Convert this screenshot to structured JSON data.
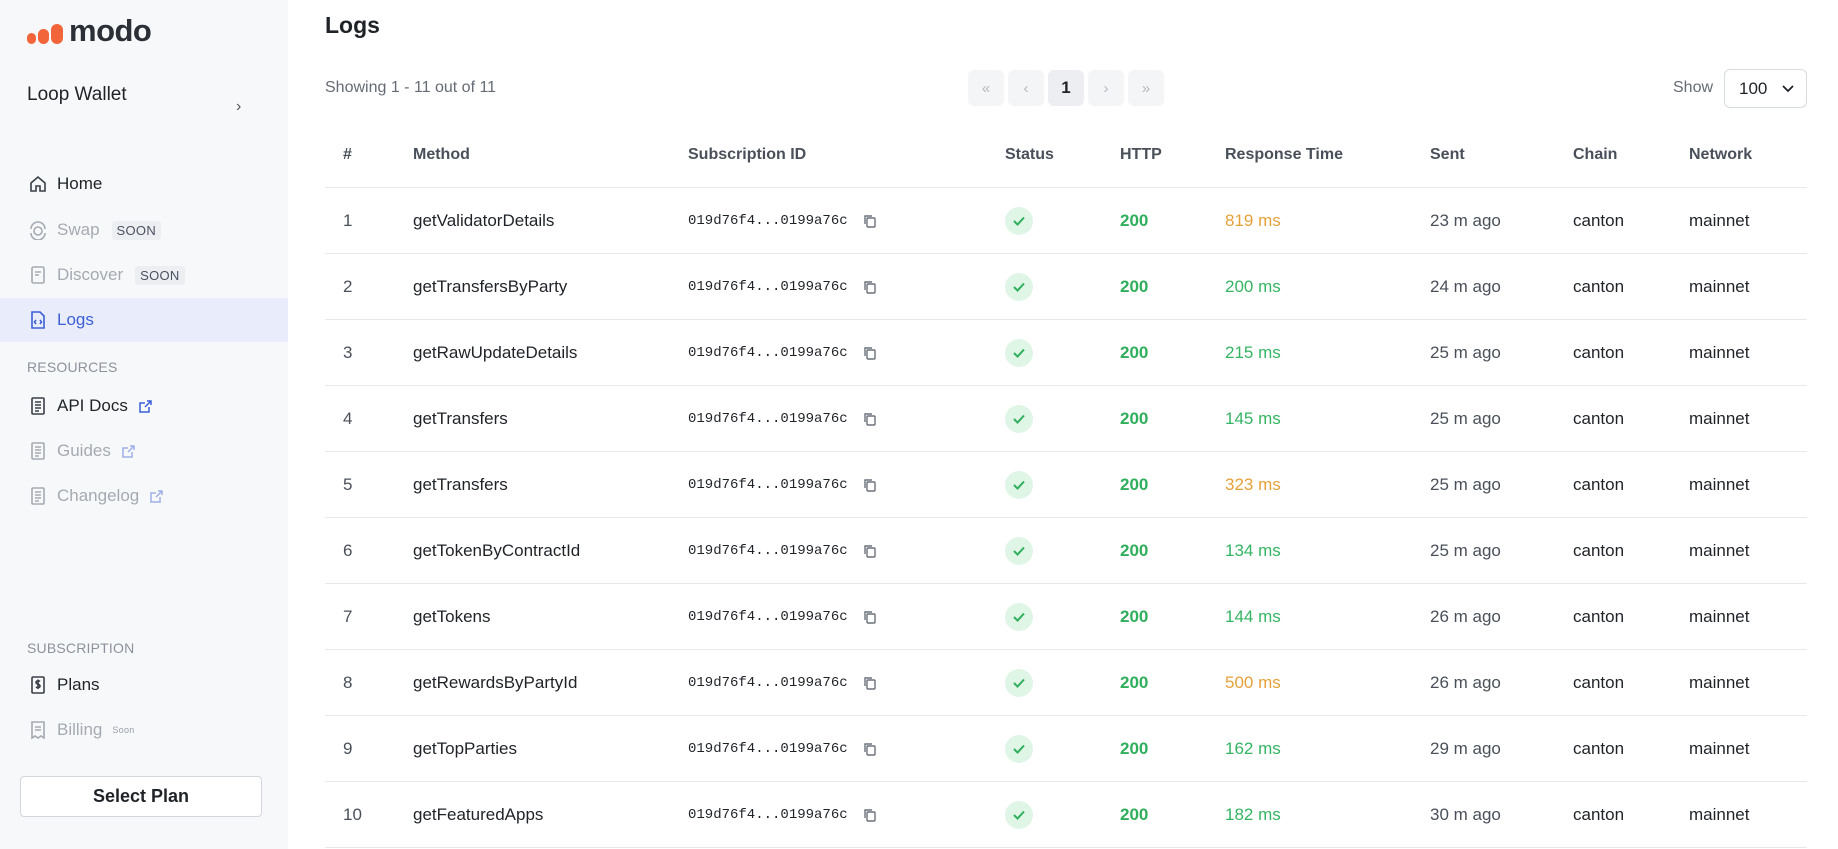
{
  "brand": {
    "name": "modo",
    "accent": "#f2643a"
  },
  "project": {
    "name": "Loop Wallet"
  },
  "nav": [
    {
      "label": "Home",
      "badge": "",
      "icon": "home-icon",
      "state": "normal"
    },
    {
      "label": "Swap",
      "badge": "SOON",
      "icon": "swap-icon",
      "state": "dim"
    },
    {
      "label": "Discover",
      "badge": "SOON",
      "icon": "document-icon",
      "state": "dim"
    },
    {
      "label": "Logs",
      "badge": "",
      "icon": "code-file-icon",
      "state": "active"
    }
  ],
  "resources": {
    "label": "RESOURCES",
    "items": [
      {
        "label": "API Docs",
        "icon": "doc-icon",
        "state": "normal"
      },
      {
        "label": "Guides",
        "icon": "doc-icon",
        "state": "dim"
      },
      {
        "label": "Changelog",
        "icon": "doc-icon",
        "state": "dim"
      }
    ]
  },
  "subscription": {
    "label": "SUBSCRIPTION",
    "items": [
      {
        "label": "Plans",
        "badge": "",
        "icon": "dollar-doc-icon",
        "state": "normal"
      },
      {
        "label": "Billing",
        "badge": "Soon",
        "icon": "receipt-icon",
        "state": "dim"
      }
    ]
  },
  "select_plan_label": "Select Plan",
  "main": {
    "title": "Logs",
    "showing": "Showing 1 - 11 out of 11",
    "pager": {
      "first": "«",
      "prev": "‹",
      "current": "1",
      "next": "›",
      "last": "»"
    },
    "show_label": "Show",
    "show_value": "100"
  },
  "table": {
    "columns": [
      "#",
      "Method",
      "Subscription ID",
      "Status",
      "HTTP",
      "Response Time",
      "Sent",
      "Chain",
      "Network"
    ],
    "rows": [
      {
        "n": "1",
        "method": "getValidatorDetails",
        "sub": "019d76f4...0199a76c",
        "http": "200",
        "rt": "819 ms",
        "rt_level": "slow",
        "sent": "23 m ago",
        "chain": "canton",
        "network": "mainnet"
      },
      {
        "n": "2",
        "method": "getTransfersByParty",
        "sub": "019d76f4...0199a76c",
        "http": "200",
        "rt": "200 ms",
        "rt_level": "fast",
        "sent": "24 m ago",
        "chain": "canton",
        "network": "mainnet"
      },
      {
        "n": "3",
        "method": "getRawUpdateDetails",
        "sub": "019d76f4...0199a76c",
        "http": "200",
        "rt": "215 ms",
        "rt_level": "fast",
        "sent": "25 m ago",
        "chain": "canton",
        "network": "mainnet"
      },
      {
        "n": "4",
        "method": "getTransfers",
        "sub": "019d76f4...0199a76c",
        "http": "200",
        "rt": "145 ms",
        "rt_level": "fast",
        "sent": "25 m ago",
        "chain": "canton",
        "network": "mainnet"
      },
      {
        "n": "5",
        "method": "getTransfers",
        "sub": "019d76f4...0199a76c",
        "http": "200",
        "rt": "323 ms",
        "rt_level": "slow",
        "sent": "25 m ago",
        "chain": "canton",
        "network": "mainnet"
      },
      {
        "n": "6",
        "method": "getTokenByContractId",
        "sub": "019d76f4...0199a76c",
        "http": "200",
        "rt": "134 ms",
        "rt_level": "fast",
        "sent": "25 m ago",
        "chain": "canton",
        "network": "mainnet"
      },
      {
        "n": "7",
        "method": "getTokens",
        "sub": "019d76f4...0199a76c",
        "http": "200",
        "rt": "144 ms",
        "rt_level": "fast",
        "sent": "26 m ago",
        "chain": "canton",
        "network": "mainnet"
      },
      {
        "n": "8",
        "method": "getRewardsByPartyId",
        "sub": "019d76f4...0199a76c",
        "http": "200",
        "rt": "500 ms",
        "rt_level": "slow",
        "sent": "26 m ago",
        "chain": "canton",
        "network": "mainnet"
      },
      {
        "n": "9",
        "method": "getTopParties",
        "sub": "019d76f4...0199a76c",
        "http": "200",
        "rt": "162 ms",
        "rt_level": "fast",
        "sent": "29 m ago",
        "chain": "canton",
        "network": "mainnet"
      },
      {
        "n": "10",
        "method": "getFeaturedApps",
        "sub": "019d76f4...0199a76c",
        "http": "200",
        "rt": "182 ms",
        "rt_level": "fast",
        "sent": "30 m ago",
        "chain": "canton",
        "network": "mainnet"
      }
    ]
  }
}
